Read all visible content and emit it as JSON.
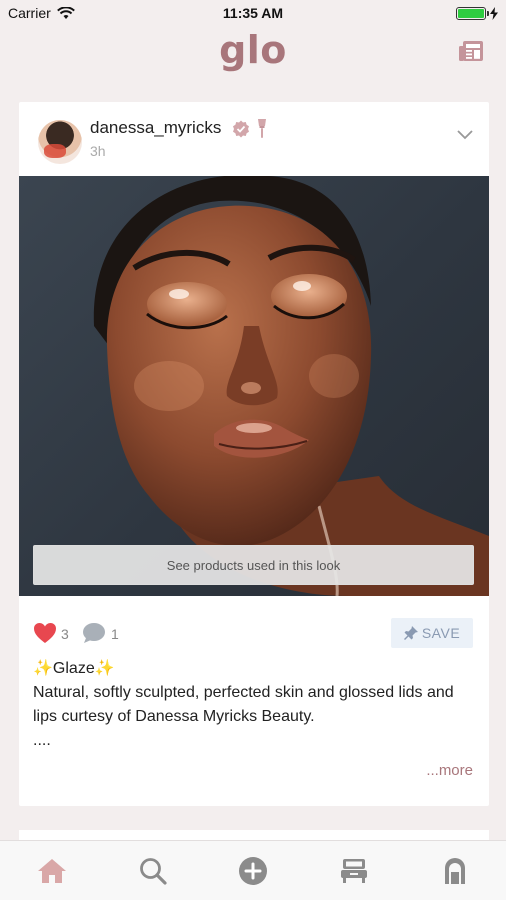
{
  "status_bar": {
    "carrier": "Carrier",
    "time": "11:35 AM",
    "battery_level": 1.0
  },
  "header": {
    "logo": "glo",
    "news_icon": "newspaper-icon"
  },
  "post": {
    "username": "danessa_myricks",
    "timestamp": "3h",
    "verified_icon": "verified-badge-icon",
    "pro_icon": "makeup-brush-icon",
    "see_products_label": "See products used in this look",
    "likes": "3",
    "comments": "1",
    "save_label": "SAVE",
    "caption_title": "✨Glaze✨",
    "caption_body": "Natural, softly sculpted, perfected skin and glossed lids and lips curtesy of Danessa Myricks Beauty.",
    "caption_ellipsis": "....",
    "more_label": "...more"
  },
  "tab_bar": {
    "items": [
      {
        "icon": "home-icon",
        "active": true
      },
      {
        "icon": "search-icon",
        "active": false
      },
      {
        "icon": "add-icon",
        "active": false
      },
      {
        "icon": "vanity-icon",
        "active": false
      },
      {
        "icon": "profile-icon",
        "active": false
      }
    ]
  },
  "colors": {
    "brand": "#a8767b",
    "like": "#e8474f",
    "save_bg": "#ebf1f8",
    "background": "#f3eeee"
  }
}
